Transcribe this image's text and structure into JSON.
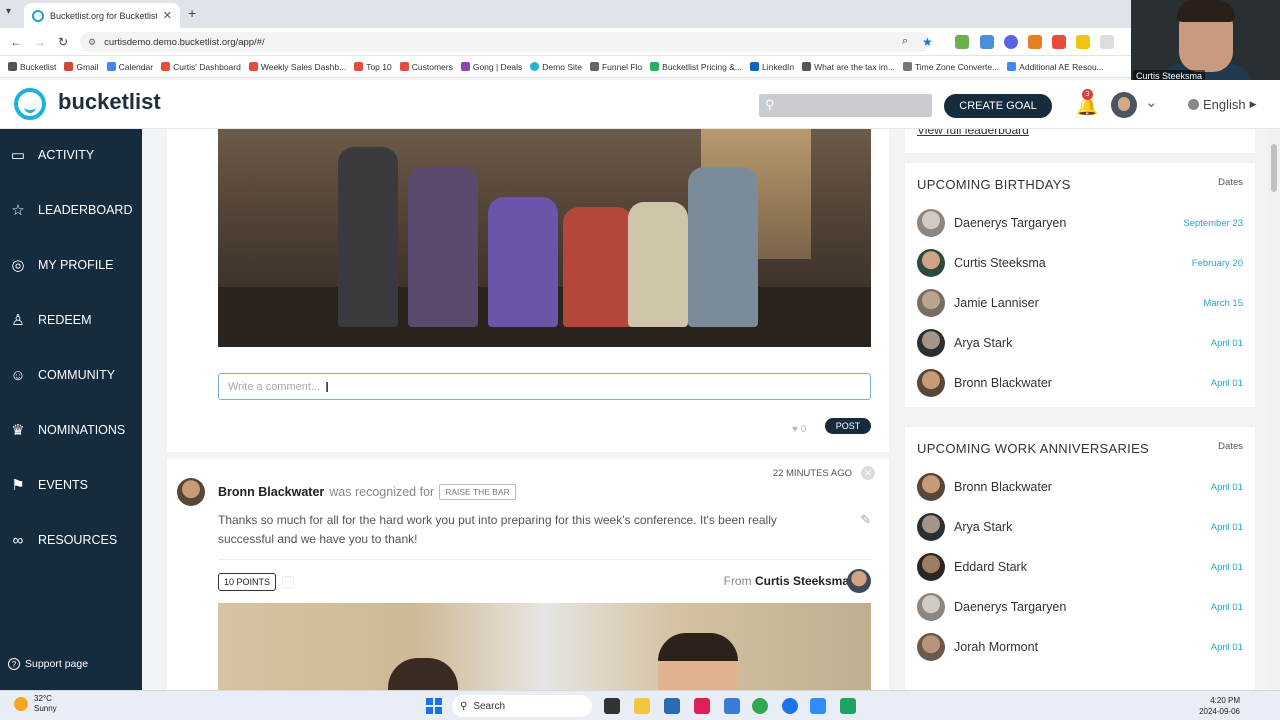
{
  "browser": {
    "tab_title": "Bucketlist.org for Bucketlist Re",
    "url": "curtisdemo.demo.bucketlist.org/app/#/",
    "bookmarks": [
      "Bucketlist",
      "Gmail",
      "Calendar",
      "Curtis' Dashboard",
      "Weekly Sales Dashb...",
      "Top 10",
      "Customers",
      "Gong | Deals",
      "Demo Site",
      "Funnel Flo",
      "Bucketlist Pricing &...",
      "LinkedIn",
      "What are the tax im...",
      "Time Zone Converte...",
      "Additional AE Resou..."
    ]
  },
  "video": {
    "name": "Curtis Steeksma"
  },
  "header": {
    "logo": "bucketlist",
    "create_goal": "CREATE GOAL",
    "notifications": "3",
    "language": "English"
  },
  "sidebar": {
    "items": [
      {
        "label": "ACTIVITY",
        "icon": "chat-icon"
      },
      {
        "label": "LEADERBOARD",
        "icon": "star-icon"
      },
      {
        "label": "MY PROFILE",
        "icon": "target-icon"
      },
      {
        "label": "REDEEM",
        "icon": "piggy-bank-icon"
      },
      {
        "label": "COMMUNITY",
        "icon": "people-icon"
      },
      {
        "label": "NOMINATIONS",
        "icon": "medal-icon"
      },
      {
        "label": "EVENTS",
        "icon": "flag-icon"
      },
      {
        "label": "RESOURCES",
        "icon": "link-icon"
      }
    ],
    "support": "Support page"
  },
  "feed": {
    "comment_placeholder": "Write a comment...",
    "likes": "0",
    "post": "POST",
    "item": {
      "time": "22 MINUTES AGO",
      "name": "Bronn Blackwater",
      "was_recognized": "was recognized for",
      "tag": "RAISE THE BAR",
      "message": "Thanks so much for all for the hard work you put into preparing for this week's conference. It's been really successful and we have you to thank!",
      "points": "10 POINTS",
      "from_label": "From",
      "from_name": "Curtis Steeksma"
    }
  },
  "right": {
    "view_leaderboard": "View full leaderboard",
    "birthdays": {
      "title": "UPCOMING BIRTHDAYS",
      "dates_label": "Dates",
      "rows": [
        {
          "name": "Daenerys Targaryen",
          "date": "September 23"
        },
        {
          "name": "Curtis Steeksma",
          "date": "February 20"
        },
        {
          "name": "Jamie Lanniser",
          "date": "March 15"
        },
        {
          "name": "Arya Stark",
          "date": "April 01"
        },
        {
          "name": "Bronn Blackwater",
          "date": "April 01"
        }
      ]
    },
    "anniversaries": {
      "title": "UPCOMING WORK ANNIVERSARIES",
      "dates_label": "Dates",
      "rows": [
        {
          "name": "Bronn Blackwater",
          "date": "April 01"
        },
        {
          "name": "Arya Stark",
          "date": "April 01"
        },
        {
          "name": "Eddard Stark",
          "date": "April 01"
        },
        {
          "name": "Daenerys Targaryen",
          "date": "April 01"
        },
        {
          "name": "Jorah Mormont",
          "date": "April 01"
        }
      ]
    }
  },
  "taskbar": {
    "temp": "32°C",
    "weather": "Sunny",
    "search": "Search",
    "time": "4:20 PM",
    "date": "2024-09-06"
  }
}
